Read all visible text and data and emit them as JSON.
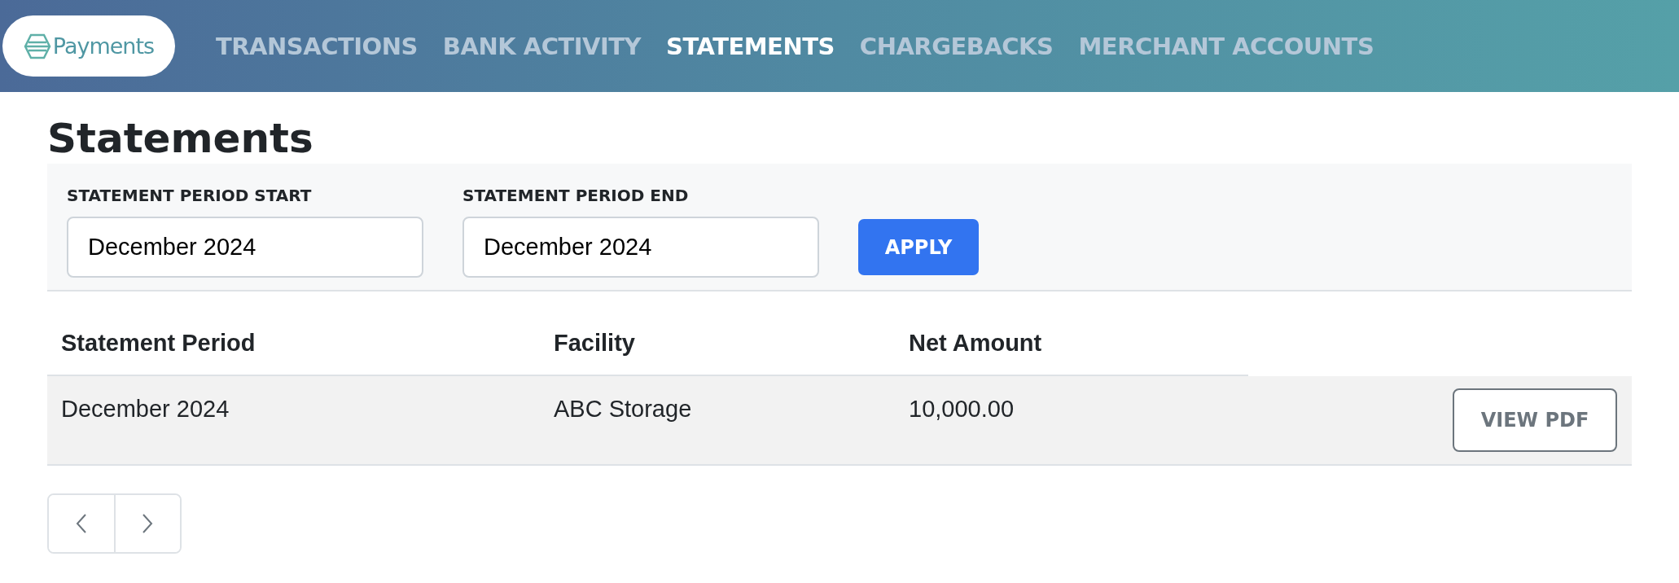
{
  "logo": {
    "text": "Payments"
  },
  "nav": [
    {
      "label": "TRANSACTIONS",
      "selected": false
    },
    {
      "label": "BANK ACTIVITY",
      "selected": false
    },
    {
      "label": "STATEMENTS",
      "selected": true
    },
    {
      "label": "CHARGEBACKS",
      "selected": false
    },
    {
      "label": "MERCHANT ACCOUNTS",
      "selected": false
    }
  ],
  "title": "Statements",
  "filters": [
    {
      "label": "STATEMENT PERIOD START",
      "value": "December 2024"
    },
    {
      "label": "STATEMENT PERIOD END",
      "value": "December 2024"
    }
  ],
  "apply_button": "APPLY",
  "table": {
    "columns": [
      "Statement Period",
      "Facility",
      "Net Amount"
    ],
    "rows": [
      {
        "cells": [
          "December 2024",
          "ABC Storage",
          "10,000.00"
        ],
        "action": "VIEW PDF"
      }
    ]
  }
}
